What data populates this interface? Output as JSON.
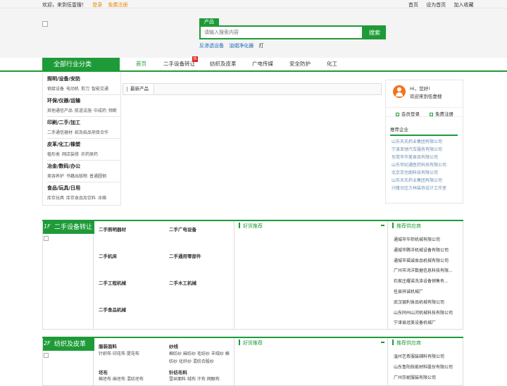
{
  "topbar": {
    "welcome": "欢迎，来到伍壹搜！",
    "login": "登录",
    "register": "免费注册",
    "links": [
      "首页",
      "设为首页",
      "加入收藏"
    ]
  },
  "search": {
    "tab": "产品",
    "placeholder": "请输入搜索内容",
    "button": "搜索",
    "hot_words": [
      "反渗透设备",
      "油烟净化器",
      "灯"
    ]
  },
  "nav": {
    "category_title": "全部行业分类",
    "items": [
      "首页",
      "二手设备转让",
      "纺织及皮革",
      "广电传媒",
      "安全防护",
      "化工"
    ],
    "active_index": 0,
    "badge_icon": "hot-badge-icon"
  },
  "categories": [
    {
      "title": "照明/设备/安防",
      "subs": [
        "钢接设备",
        "电动机",
        "剪刀",
        "智能交通"
      ]
    },
    {
      "title": "环保/仪器/运输",
      "subs": [
        "其他通信产品",
        "航道设施",
        "中成药",
        "频断"
      ]
    },
    {
      "title": "印刷/二手/加工",
      "subs": [
        "二手通信器材",
        "纸及纸品项目合作"
      ]
    },
    {
      "title": "皮革/化工/橡塑",
      "subs": [
        "植形类",
        "网店装修",
        "农药原药"
      ]
    },
    {
      "title": "冶金/数码/办公",
      "subs": [
        "美容养护",
        "书籍出版物",
        "普通圆钢"
      ]
    },
    {
      "title": "食品/玩具/日用",
      "subs": [
        "库存玩具",
        "库存食品及饮料",
        "冰箱"
      ]
    }
  ],
  "middle": {
    "tab": "最新产品"
  },
  "login_box": {
    "hello": "Hi，您好!",
    "welcome": "欢迎来到伍壹搜",
    "member_login": "会员登录",
    "free_register": "免费注册",
    "recommend_title": "推荐企业",
    "companies": [
      "山东天氏药业集团有限公司",
      "宁波亚驰汽车服务有限公司",
      "东莞市华美食品有限公司",
      "山东世纪通医药科技有限公司",
      "北京京也朗科技有限公司",
      "山东天氏药业集团有限公司",
      "兴隆台区方林装饰设计工作室"
    ]
  },
  "floors": [
    {
      "num": "1F",
      "name": "二手设备转让",
      "cells": [
        "二手照明器材",
        "二手广电设备",
        "二手机床",
        "二手通用零部件",
        "二手工程机械",
        "二手木工机械",
        "二手食品机械"
      ],
      "hot_title": "好货推荐",
      "sup_title": "推荐供应商",
      "suppliers": [
        "通城市华邦机械有限公司",
        "通城市腾洋机械设备有限公司",
        "通城市福诚食品机械有限公司",
        "广州市鸿洋数据信息科技有限...",
        "石家庄耀诺洗涤设备销售有...",
        "任县祥诚机械厂",
        "武汉银利食品机械有限公司",
        "山东同州山河机械科技有限公司",
        "宁津县冠美设备机械厂"
      ]
    },
    {
      "num": "2F",
      "name": "纺织及皮革",
      "groups": [
        {
          "title": "服装面料",
          "subs": [
            "针织布",
            "印花布",
            "提花布"
          ]
        },
        {
          "title": "纱线",
          "subs": [
            "棉纺纱",
            "麻纺纱",
            "毛纺纱",
            "羊绒纱",
            "棉纺纱",
            "化纤纱",
            "混纺合股纱"
          ]
        },
        {
          "title": "坯布",
          "subs": [
            "棉坯布",
            "麻坯布",
            "混纺坯布"
          ]
        },
        {
          "title": "针纺布料",
          "subs": [
            "雪丝面料",
            "绒布",
            "汗布",
            "网眼布"
          ]
        }
      ],
      "hot_title": "好货推荐",
      "sup_title": "推荐供应商",
      "suppliers": [
        "温州艺希服装辅料有限公司",
        "山东鲁阳技能材料股份有限公司",
        "广州莎妮服装有限公司"
      ]
    }
  ]
}
